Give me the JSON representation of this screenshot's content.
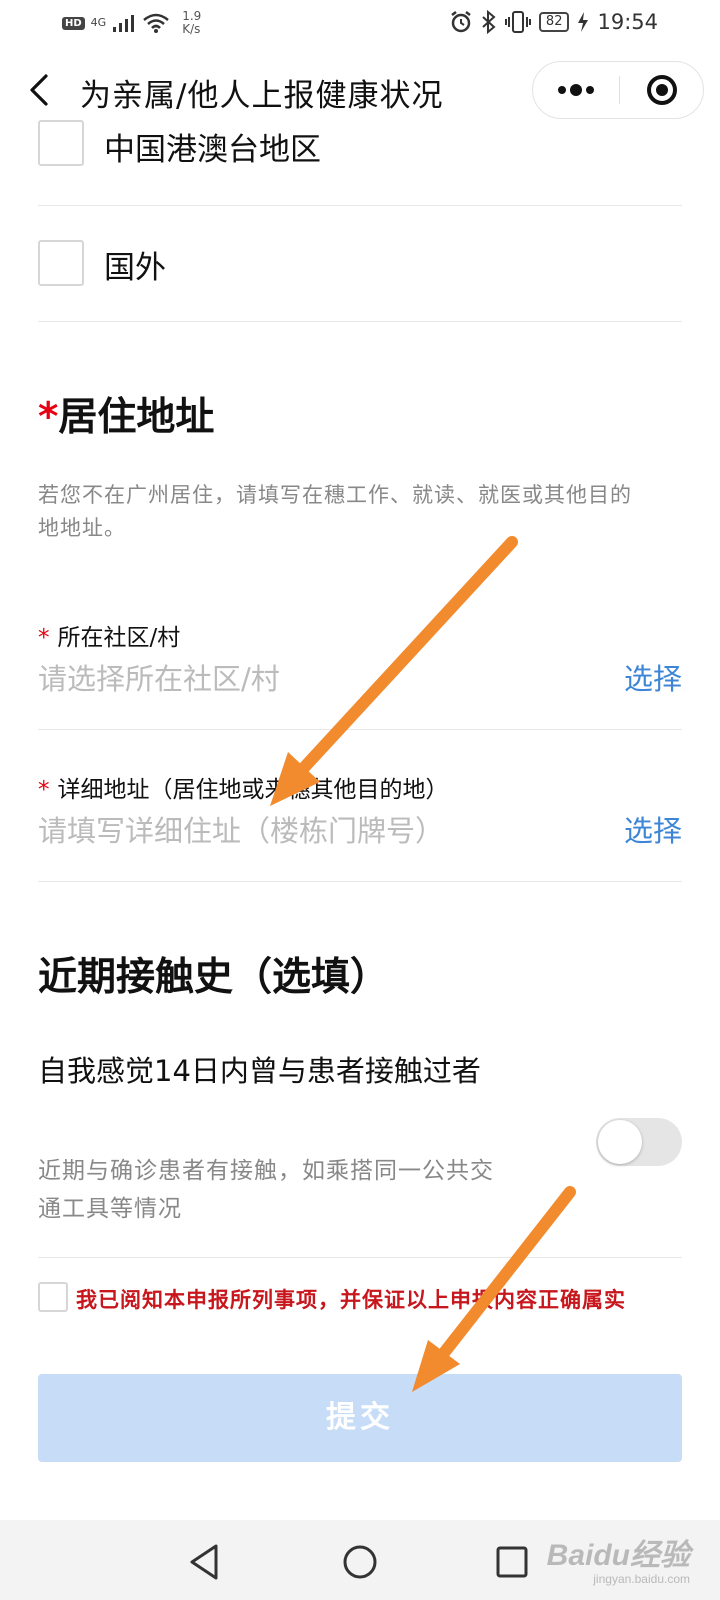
{
  "status_bar": {
    "hd_badge": "HD",
    "network": "4G",
    "speed_value": "1.9",
    "speed_unit": "K/s",
    "battery": "82",
    "time": "19:54"
  },
  "header": {
    "title": "为亲属/他人上报健康状况",
    "back_icon": "chevron-left-icon",
    "more_icon": "more-dots-icon",
    "close_icon": "target-circle-icon"
  },
  "region_options": [
    {
      "label": "中国港澳台地区",
      "checked": false
    },
    {
      "label": "国外",
      "checked": false
    }
  ],
  "address_section": {
    "required_mark": "*",
    "title": "居住地址",
    "hint": "若您不在广州居住，请填写在穗工作、就读、就医或其他目的地地址。",
    "fields": [
      {
        "required": "*",
        "label": "所在社区/村",
        "placeholder": "请选择所在社区/村",
        "action": "选择"
      },
      {
        "required": "*",
        "label": "详细地址（居住地或来穗其他目的地）",
        "placeholder": "请填写详细住址（楼栋门牌号）",
        "action": "选择"
      }
    ]
  },
  "contact_section": {
    "title": "近期接触史（选填）",
    "question": "自我感觉14日内曾与患者接触过者",
    "hint": "近期与确诊患者有接触，如乘搭同一公共交通工具等情况",
    "toggle_on": false
  },
  "agreement": {
    "text": "我已阅知本申报所列事项，并保证以上申报内容正确属实",
    "checked": false
  },
  "submit": {
    "label": "提交"
  },
  "watermark": {
    "main": "Baidu经验",
    "sub": "jingyan.baidu.com"
  },
  "colors": {
    "accent_blue": "#3d86d6",
    "required_red": "#e60012",
    "agree_red": "#c8161d",
    "submit_disabled": "#c6dcf7",
    "annotation_arrow": "#f28a2e"
  }
}
